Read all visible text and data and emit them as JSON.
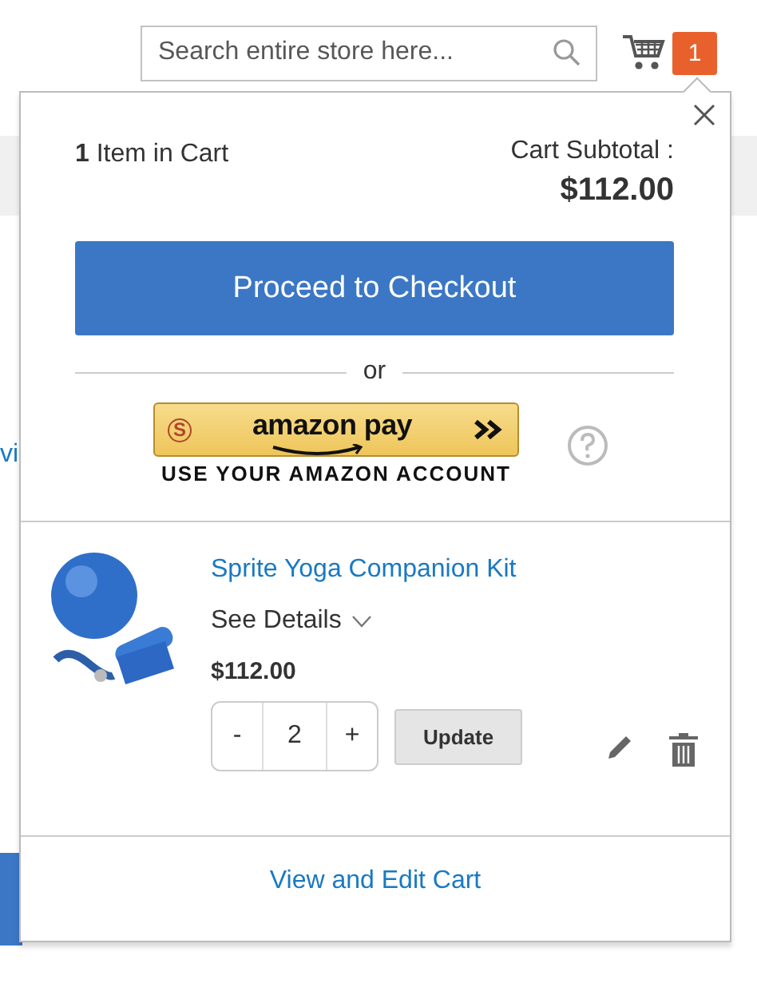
{
  "header": {
    "search": {
      "placeholder": "Search entire store here..."
    },
    "cart_count": "1"
  },
  "background": {
    "link_fragment": "vi"
  },
  "minicart": {
    "item_count": "**1** Item in Cart",
    "subtotal_label": "Cart Subtotal :",
    "subtotal": "$112.00",
    "checkout_button": "Proceed to Checkout",
    "separator": "or",
    "amazon_pay": {
      "badge_letter": "S",
      "logo_text": "amazon pay",
      "caption": "USE YOUR AMAZON ACCOUNT"
    },
    "items": [
      {
        "name": "Sprite Yoga Companion Kit",
        "details_toggle": "See Details",
        "details_expanded": false,
        "price": "$112.00",
        "decrement": "-",
        "quantity": "2",
        "increment": "+",
        "update_button": "Update"
      }
    ],
    "view_cart_link": "View and Edit Cart"
  }
}
